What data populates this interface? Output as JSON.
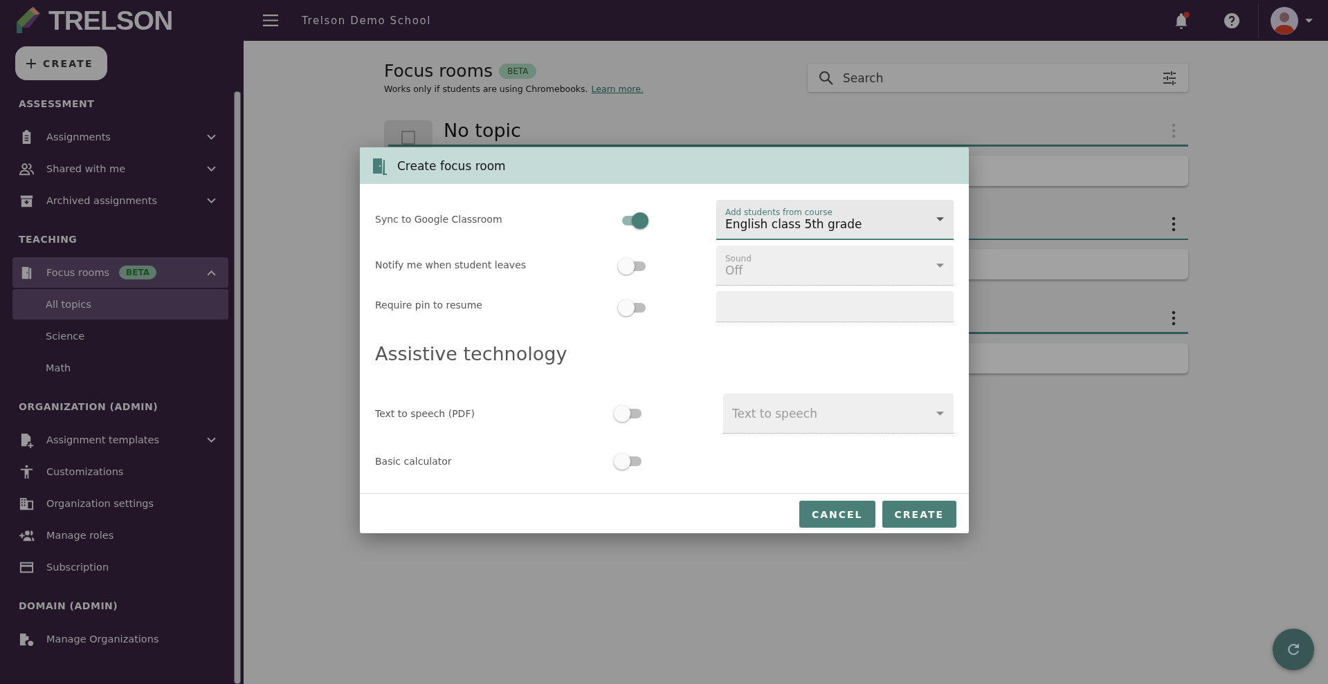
{
  "header": {
    "logo_text": "TRELSON",
    "school": "Trelson Demo School",
    "has_notification": true
  },
  "sidebar": {
    "create_label": "CREATE",
    "sections": [
      {
        "heading": "ASSESSMENT",
        "items": [
          {
            "label": "Assignments",
            "expanded": false,
            "selected": false
          },
          {
            "label": "Shared with me",
            "expanded": false,
            "selected": false
          },
          {
            "label": "Archived assignments",
            "expanded": false,
            "selected": false
          }
        ]
      },
      {
        "heading": "TEACHING",
        "items": [
          {
            "label": "Focus rooms",
            "badge": "BETA",
            "expanded": true,
            "selected": true,
            "children": [
              {
                "label": "All topics",
                "selected": true
              },
              {
                "label": "Science",
                "selected": false
              },
              {
                "label": "Math",
                "selected": false
              }
            ]
          }
        ]
      },
      {
        "heading": "ORGANIZATION (ADMIN)",
        "items": [
          {
            "label": "Assignment templates",
            "expanded": false,
            "selected": false
          },
          {
            "label": "Customizations",
            "selected": false
          },
          {
            "label": "Organization settings",
            "selected": false
          },
          {
            "label": "Manage roles",
            "selected": false
          },
          {
            "label": "Subscription",
            "selected": false
          }
        ]
      },
      {
        "heading": "DOMAIN (ADMIN)",
        "items": [
          {
            "label": "Manage Organizations",
            "selected": false
          }
        ]
      }
    ]
  },
  "page": {
    "title": "Focus rooms",
    "badge": "BETA",
    "note": "Works only if students are using Chromebooks.",
    "note_link": "Learn more.",
    "search": {
      "placeholder": "Search"
    },
    "topics": [
      {
        "title": "No topic",
        "checked": false
      }
    ]
  },
  "dialog": {
    "title": "Create focus room",
    "rows": [
      {
        "label": "Sync to Google Classroom",
        "on": true,
        "field": {
          "kind": "select",
          "label": "Add students from course",
          "value": "English class 5th grade",
          "focused": true,
          "disabled": false
        }
      },
      {
        "label": "Notify me when student leaves",
        "on": false,
        "field": {
          "kind": "select",
          "label": "Sound",
          "value": "Off",
          "focused": false,
          "disabled": true
        }
      },
      {
        "label": "Require pin to resume",
        "on": false,
        "field": {
          "kind": "text",
          "focused": false,
          "disabled": true
        }
      }
    ],
    "section_title": "Assistive technology",
    "assistive": [
      {
        "label": "Text to speech (PDF)",
        "on": false,
        "field": {
          "kind": "select",
          "placeholder": "Text to speech",
          "focused": false,
          "disabled": true
        }
      },
      {
        "label": "Basic calculator",
        "on": false
      }
    ],
    "buttons": [
      "CANCEL",
      "CREATE"
    ]
  }
}
